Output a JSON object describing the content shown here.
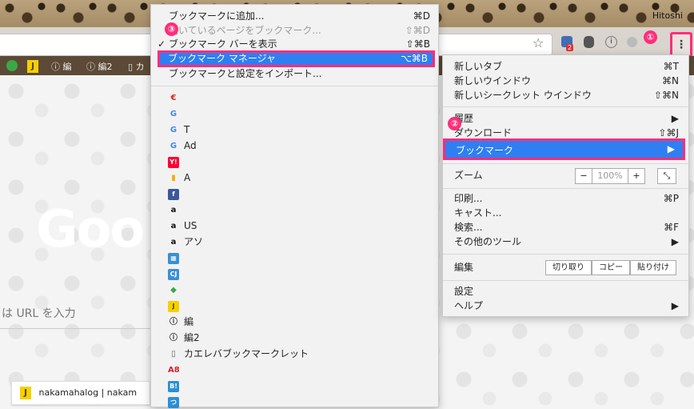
{
  "window": {
    "user_name": "Hitoshi"
  },
  "bookmarks_bar": {
    "items": [
      {
        "label": "",
        "icon": "green-leaf-icon"
      },
      {
        "label": "J",
        "icon": "j-icon"
      },
      {
        "label": "編",
        "icon": "circle-i-icon"
      },
      {
        "label": "編2",
        "icon": "circle-i-icon"
      },
      {
        "label": "カ",
        "icon": "page-icon"
      }
    ]
  },
  "page": {
    "google_logo": "Goo",
    "search_hint": "は URL を入力",
    "tile_label": "nakamahalog | nakam"
  },
  "extensions": {
    "pocket_badge": "2",
    "menu_glyph": "⋮"
  },
  "callouts": {
    "one": "①",
    "two": "②",
    "three": "③"
  },
  "bookmark_menu": {
    "items": [
      {
        "label": "ブックマークに追加...",
        "shortcut": "⌘D",
        "disabled": false
      },
      {
        "label": "開いているページをブックマーク...",
        "shortcut": "⇧⌘D",
        "disabled": true
      },
      {
        "label": "✓ ブックマーク バーを表示",
        "shortcut": "⇧⌘B",
        "disabled": false
      },
      {
        "label": "ブックマーク マネージャ",
        "shortcut": "⌥⌘B",
        "highlighted": true
      },
      {
        "label": "ブックマークと設定をインポート...",
        "shortcut": "",
        "disabled": false
      }
    ],
    "bookmarks": [
      {
        "label": "",
        "icon": "euro-icon",
        "color": "#e0251b"
      },
      {
        "label": "",
        "icon": "google-icon",
        "color": "#4285f4"
      },
      {
        "label": "T",
        "icon": "google-icon",
        "color": "#4285f4"
      },
      {
        "label": "Ad",
        "icon": "google-icon",
        "color": "#4285f4"
      },
      {
        "label": "",
        "icon": "yahoo-icon",
        "color": "#ff0033"
      },
      {
        "label": "A",
        "icon": "analytics-icon",
        "color": "#f9ab00"
      },
      {
        "label": "",
        "icon": "facebook-icon",
        "color": "#3b5998"
      },
      {
        "label": "",
        "icon": "amazon-icon",
        "color": "#111111"
      },
      {
        "label": "US",
        "icon": "amazon-icon",
        "color": "#111111"
      },
      {
        "label": "アソ",
        "icon": "amazon-icon",
        "color": "#111111"
      },
      {
        "label": "",
        "icon": "scan-icon",
        "color": "#3a8fd6"
      },
      {
        "label": "",
        "icon": "cj-icon",
        "color": "#3a8fd6"
      },
      {
        "label": "",
        "icon": "green-leaf-icon",
        "color": "#3aa845"
      },
      {
        "label": "",
        "icon": "j-icon",
        "color": "#f5d000"
      },
      {
        "label": "編",
        "icon": "circle-i-icon",
        "color": "#222222"
      },
      {
        "label": "編2",
        "icon": "circle-i-icon",
        "color": "#222222"
      },
      {
        "label": "カエレバブックマークレット",
        "icon": "page-icon",
        "color": "#666666"
      },
      {
        "label": "",
        "icon": "a8-icon",
        "color": "#d91e2a"
      },
      {
        "label": "",
        "icon": "hatena-icon",
        "color": "#2a8fd6"
      },
      {
        "label": "",
        "icon": "tsu-icon",
        "color": "#2a8fd6"
      }
    ]
  },
  "main_menu": {
    "new_tab": {
      "label": "新しいタブ",
      "shortcut": "⌘T"
    },
    "new_window": {
      "label": "新しいウインドウ",
      "shortcut": "⌘N"
    },
    "new_incognito": {
      "label": "新しいシークレット ウインドウ",
      "shortcut": "⇧⌘N"
    },
    "history": {
      "label": "履歴",
      "arrow": "▶"
    },
    "downloads": {
      "label": "ダウンロード",
      "shortcut": "⇧⌘J"
    },
    "bookmarks": {
      "label": "ブックマーク",
      "arrow": "▶"
    },
    "zoom": {
      "label": "ズーム",
      "minus": "−",
      "value": "100%",
      "plus": "+",
      "fullscreen": "⤡"
    },
    "print": {
      "label": "印刷...",
      "shortcut": "⌘P"
    },
    "cast": {
      "label": "キャスト..."
    },
    "find": {
      "label": "検索...",
      "shortcut": "⌘F"
    },
    "more_tools": {
      "label": "その他のツール",
      "arrow": "▶"
    },
    "edit": {
      "label": "編集",
      "cut": "切り取り",
      "copy": "コピー",
      "paste": "貼り付け"
    },
    "settings": {
      "label": "設定"
    },
    "help": {
      "label": "ヘルプ",
      "arrow": "▶"
    }
  }
}
